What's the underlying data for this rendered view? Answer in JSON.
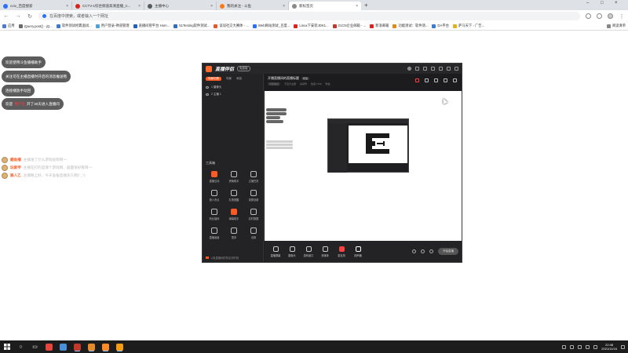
{
  "browser": {
    "tabs": [
      {
        "label": "cctv_百度搜索",
        "color": "#2b6fff",
        "active": false
      },
      {
        "label": "CCTV-1综合频道高清直播_C...",
        "color": "#d7261d",
        "active": false
      },
      {
        "label": "主播中心",
        "color": "#5a5a5a",
        "active": false
      },
      {
        "label": "我的关注 - 斗鱼",
        "color": "#ff7a1c",
        "active": false
      },
      {
        "label": "新标签页",
        "color": "#8a8a8a",
        "active": true
      }
    ],
    "new_tab": "+",
    "address_placeholder": "在百度中搜索，或者输入一个网址",
    "bookmarks": [
      {
        "label": "应用",
        "color": "#4a7ad6"
      },
      {
        "label": "jQuery.post() - jQ...",
        "color": "#6a6a6a"
      },
      {
        "label": "软件测试经典面试...",
        "color": "#3a7bd5"
      },
      {
        "label": "用户登录-禅道管理",
        "color": "#4aa3df"
      },
      {
        "label": "直播间管平台 Hom...",
        "color": "#2060c0"
      },
      {
        "label": "51Testing软件测试...",
        "color": "#2f6fbf"
      },
      {
        "label": "谈谈社交大赛体 - ...",
        "color": "#e25b2a"
      },
      {
        "label": "Web网站测试_百度...",
        "color": "#2b6fff"
      },
      {
        "label": "Linux下安装JDK1...",
        "color": "#d7261d"
      },
      {
        "label": "21CN企业邮箱 - ...",
        "color": "#c0392b"
      },
      {
        "label": "新浪邮箱",
        "color": "#d7261d"
      },
      {
        "label": "功能测试：软件测...",
        "color": "#e08a1c"
      },
      {
        "label": "DA平台",
        "color": "#3a7bd5"
      },
      {
        "label": "萨马天下 - 广告...",
        "color": "#e0b020"
      }
    ],
    "bookmarks_right": "阅读清单"
  },
  "overlay": {
    "bubbles": [
      {
        "text": "欢迎使用斗鱼播播助手"
      },
      {
        "text": "关注可在主播直播时开启的消息推送哦"
      },
      {
        "text": "连接播放手动回"
      },
      {
        "prefix": "欢迎",
        "name": "用户名",
        "suffix": "开了30天进入直播间"
      }
    ],
    "comments": [
      {
        "user": "鲲鱼播",
        "user_color": "#ff5a24",
        "text": "主播发了什么游戏视频啊～"
      },
      {
        "user": "玩家甲",
        "user_color": "#ff5a24",
        "text": "主播在打的是哪个游戏啊，画面很好看呀～"
      },
      {
        "user": "路人乙",
        "user_color": "#ff5a24",
        "text": "主播晚上好，今天准备直播多久啊(^_^)"
      }
    ]
  },
  "app": {
    "name": "直播伴侣",
    "badge": "免费版",
    "scene_tabs": [
      "场景切换",
      "场景",
      "添加"
    ],
    "sources": [
      "1 摄像头",
      "2 主播 1"
    ],
    "tools_heading": "工具箱",
    "tools": [
      {
        "label": "直播互动",
        "hot": true
      },
      {
        "label": "房管助手",
        "hot": false
      },
      {
        "label": "主播任务",
        "hot": false
      },
      {
        "label": "狼人杀点",
        "hot": false
      },
      {
        "label": "礼物提醒",
        "hot": false
      },
      {
        "label": "录屏设置",
        "hot": false
      },
      {
        "label": "粉丝福利",
        "hot": false
      },
      {
        "label": "弹幕助手",
        "hot": true
      },
      {
        "label": "实时数据",
        "hot": false
      },
      {
        "label": "直播画面",
        "hot": false
      },
      {
        "label": "更多",
        "hot": false
      },
      {
        "label": "设置",
        "hot": false
      }
    ],
    "footer": "斗鱼直播间的特定用时段",
    "room_title": "开播直播间的直播标题",
    "room_tag": "修改",
    "room_meta": [
      "分区信息",
      "不显示主题",
      "房间号",
      "热度 1769",
      "粉丝"
    ],
    "bottom_tools": [
      {
        "label": "直播屏幕",
        "style": ""
      },
      {
        "label": "摄像头",
        "style": ""
      },
      {
        "label": "游戏窗口",
        "style": ""
      },
      {
        "label": "多媒体",
        "style": ""
      },
      {
        "label": "麦克风",
        "style": "red"
      },
      {
        "label": "扬声器",
        "style": "white"
      }
    ],
    "start_button": "开始直播"
  },
  "taskbar": {
    "time": "22:48",
    "date": "2021/11/16",
    "apps": [
      {
        "color": "#e8453c"
      },
      {
        "color": "#4a90d9"
      },
      {
        "color": "#c0392b"
      },
      {
        "color": "#e58a2a"
      },
      {
        "color": "#ff8a2a"
      },
      {
        "color": "#f39c12"
      }
    ]
  }
}
